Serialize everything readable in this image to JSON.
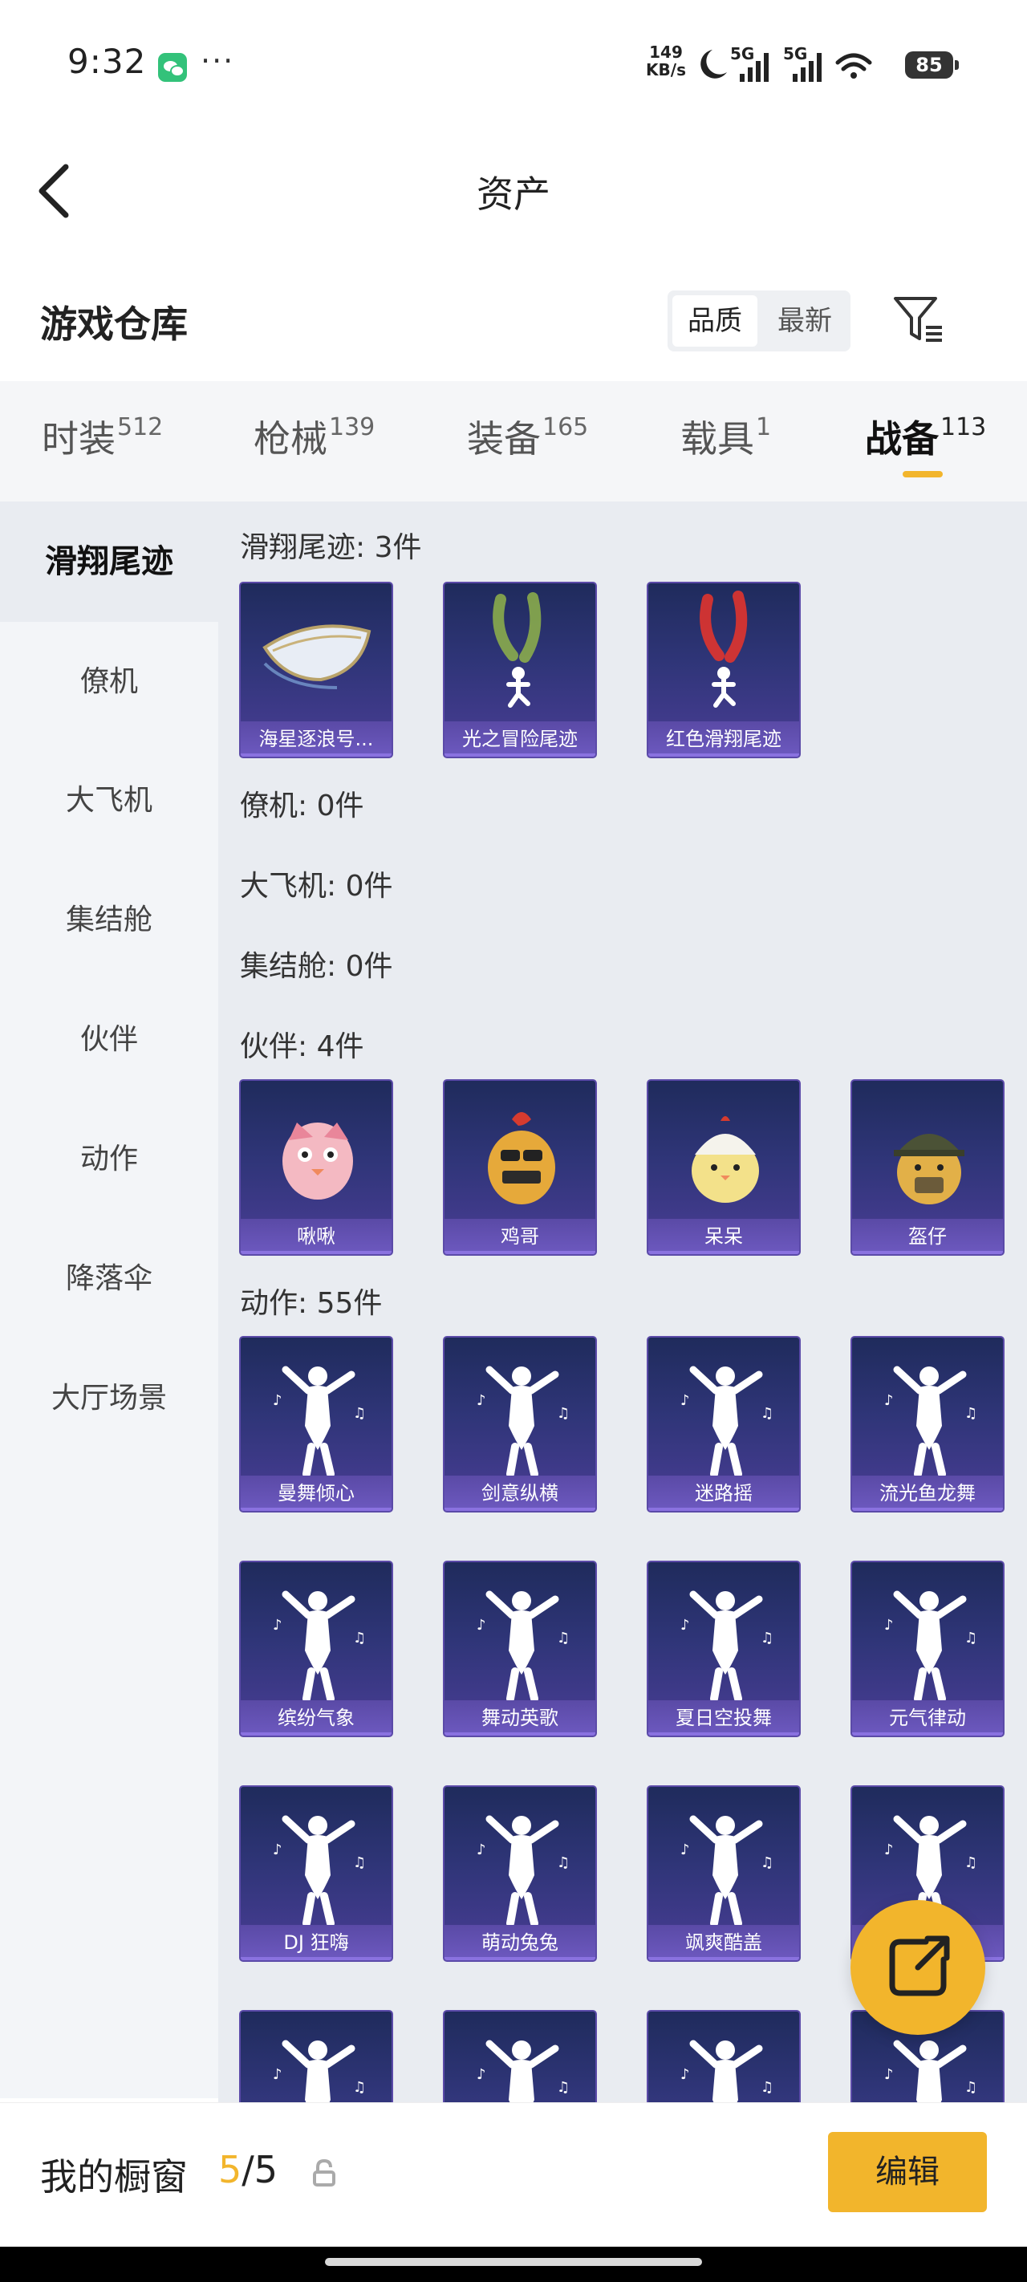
{
  "status_bar": {
    "time": "9:32",
    "more": "···",
    "speed_value": "149",
    "speed_unit": "KB/s",
    "network_1": "5G",
    "network_2": "5G",
    "battery": "85",
    "icons": [
      "wechat-icon",
      "moon-icon",
      "signal-icon",
      "wifi-icon",
      "battery-icon"
    ]
  },
  "nav": {
    "title": "资产",
    "back_icon": "chevron-left-icon"
  },
  "warehouse": {
    "title": "游戏仓库",
    "sort_options": [
      "品质",
      "最新"
    ],
    "sort_selected": "品质",
    "filter_icon": "filter-icon"
  },
  "tabs": [
    {
      "label": "时装",
      "count": "512"
    },
    {
      "label": "枪械",
      "count": "139"
    },
    {
      "label": "装备",
      "count": "165"
    },
    {
      "label": "载具",
      "count": "1"
    },
    {
      "label": "战备",
      "count": "113"
    }
  ],
  "active_tab": "战备",
  "sidebar": {
    "items": [
      "滑翔尾迹",
      "僚机",
      "大飞机",
      "集结舱",
      "伙伴",
      "动作",
      "降落伞",
      "大厅场景"
    ],
    "active": "滑翔尾迹"
  },
  "sections": {
    "glide": {
      "title": "滑翔尾迹: 3件",
      "items": [
        "海星逐浪号...",
        "光之冒险尾迹",
        "红色滑翔尾迹"
      ]
    },
    "wingman": {
      "title": "僚机: 0件"
    },
    "plane": {
      "title": "大飞机: 0件"
    },
    "pod": {
      "title": "集结舱: 0件"
    },
    "partner": {
      "title": "伙伴: 4件",
      "items": [
        "啾啾",
        "鸡哥",
        "呆呆",
        "盔仔"
      ]
    },
    "action": {
      "title": "动作: 55件",
      "items": [
        "曼舞倾心",
        "剑意纵横",
        "迷路摇",
        "流光鱼龙舞",
        "缤纷气象",
        "舞动英歌",
        "夏日空投舞",
        "元气律动",
        "DJ 狂嗨",
        "萌动兔兔",
        "飒爽酷盖",
        "",
        "",
        "",
        "",
        ""
      ]
    }
  },
  "fab_icon": "share-external-icon",
  "bottom": {
    "label": "我的橱窗",
    "current": "5",
    "separator": "/",
    "total": "5",
    "lock_icon": "lock-icon",
    "edit_label": "编辑"
  },
  "colors": {
    "accent": "#f2b52c",
    "card_top": "#1f2b5c",
    "card_bottom": "#4a3d96",
    "content_bg": "#e9ecf1"
  }
}
